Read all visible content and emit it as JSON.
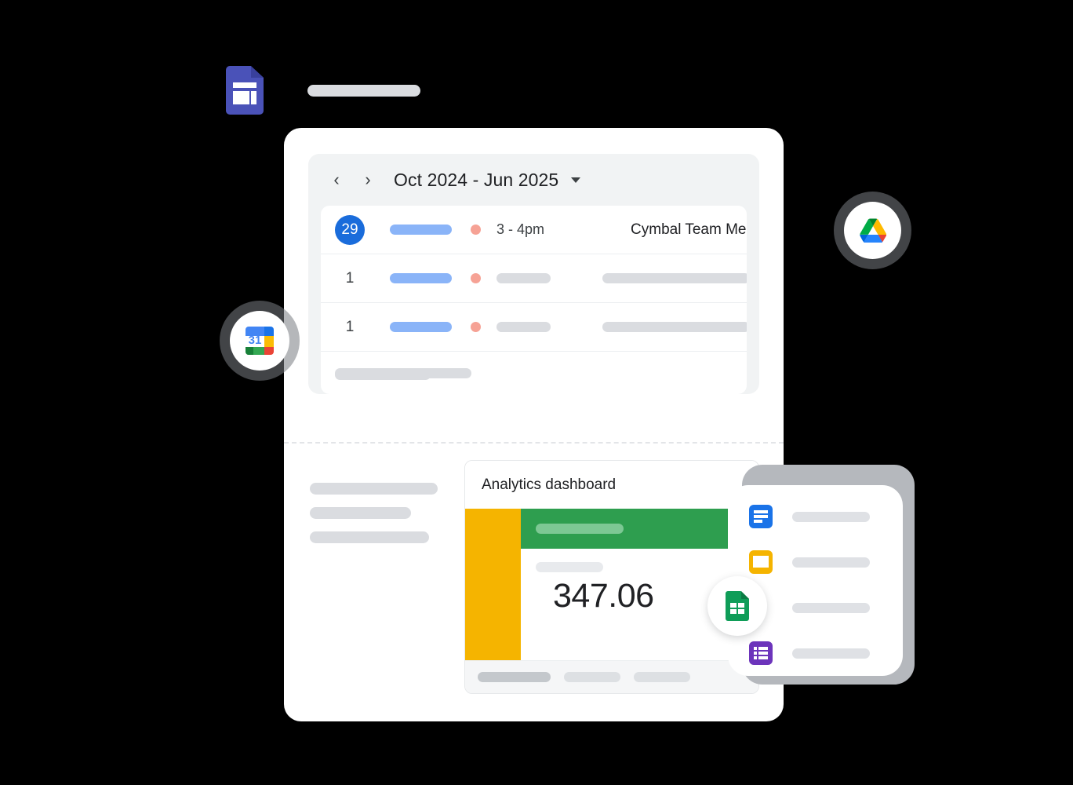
{
  "top_file": {
    "icon": "slides-file-icon",
    "label_placeholder": ""
  },
  "calendar": {
    "prev_label": "‹",
    "next_label": "›",
    "range": "Oct 2024 - Jun 2025",
    "caret": "dropdown-caret",
    "rows": [
      {
        "day": "29",
        "active": true,
        "time": "3 - 4pm",
        "title": "Cymbal Team Meeting"
      },
      {
        "day": "1",
        "active": false,
        "time": "",
        "title": ""
      },
      {
        "day": "1",
        "active": false,
        "time": "",
        "title": ""
      }
    ]
  },
  "dashboard": {
    "title": "Analytics dashboard",
    "value": "347.06",
    "footer_tabs": [
      "",
      "",
      ""
    ],
    "colors": {
      "orange": "#f5b400",
      "green": "#2e9e4f",
      "blue": "#1a73e8",
      "purple": "#6c34bb"
    }
  },
  "right_panel": {
    "items": [
      {
        "icon": "docs-icon",
        "label": ""
      },
      {
        "icon": "slides-icon",
        "label": ""
      },
      {
        "icon": "sheets-icon",
        "label": ""
      },
      {
        "icon": "forms-icon",
        "label": ""
      }
    ]
  },
  "badges": {
    "calendar": {
      "icon": "google-calendar-icon",
      "day": "31"
    },
    "drive": {
      "icon": "google-drive-icon"
    },
    "sheets": {
      "icon": "google-sheets-icon"
    }
  }
}
